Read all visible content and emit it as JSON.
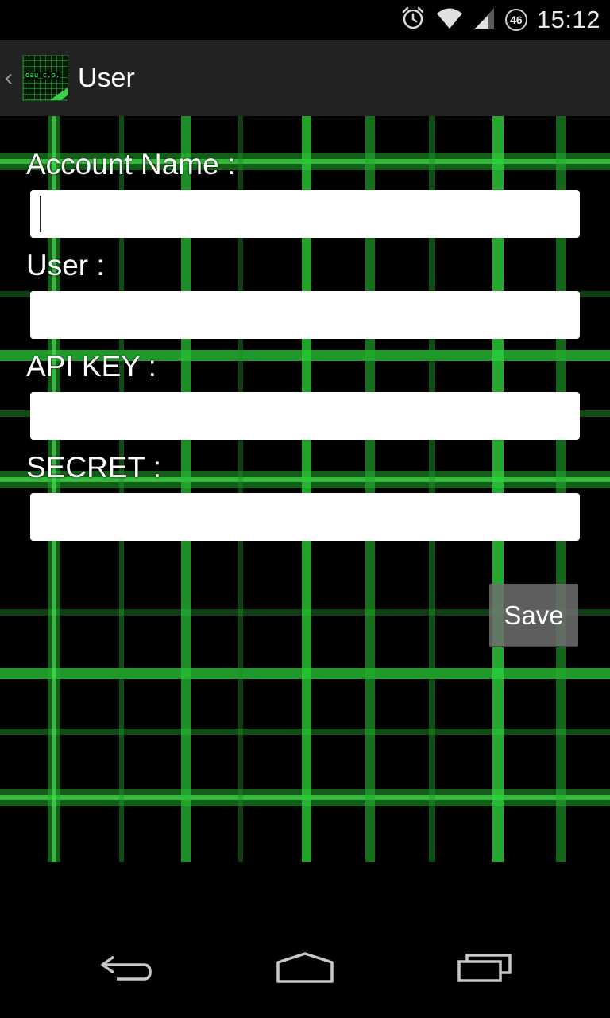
{
  "status_bar": {
    "time": "15:12",
    "network_badge": "46",
    "icons": [
      "alarm-icon",
      "wifi-icon",
      "signal-icon"
    ]
  },
  "action_bar": {
    "title": "User",
    "app_icon_text": "dau_c.o."
  },
  "form": {
    "account_name_label": "Account Name :",
    "account_name_value": "",
    "user_label": "User :",
    "user_value": "",
    "api_key_label": "API KEY :",
    "api_key_value": "",
    "secret_label": "SECRET :",
    "secret_value": "",
    "save_label": "Save"
  },
  "nav_bar": {
    "buttons": [
      "back-icon",
      "home-icon",
      "recent-apps-icon"
    ]
  },
  "colors": {
    "background": "#000000",
    "action_bar": "#222222",
    "grid_accent": "#3cdc46",
    "save_button": "#6e6e6e"
  }
}
